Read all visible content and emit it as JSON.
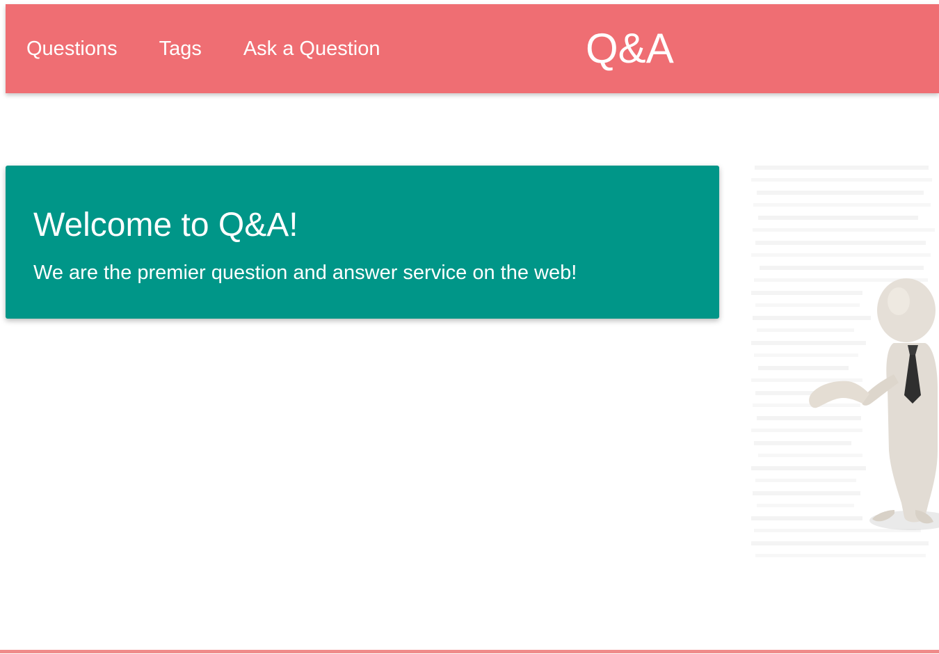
{
  "navbar": {
    "links": [
      {
        "label": "Questions"
      },
      {
        "label": "Tags"
      },
      {
        "label": "Ask a Question"
      }
    ],
    "brand": "Q&A"
  },
  "hero": {
    "title": "Welcome to Q&A!",
    "subtitle": "We are the premier question and answer service on the web!"
  },
  "colors": {
    "navbar_bg": "#ef6e73",
    "card_bg": "#009688",
    "text_on_color": "#ffffff",
    "footer_rule": "#ef8b8a"
  }
}
